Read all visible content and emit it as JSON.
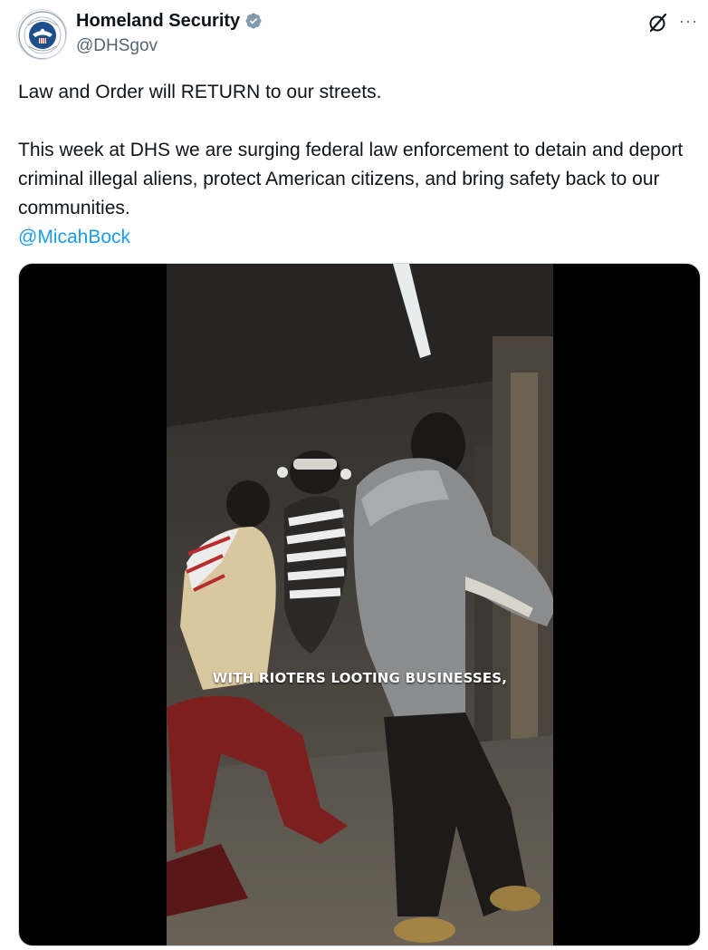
{
  "author": {
    "display_name": "Homeland Security",
    "handle": "@DHSgov",
    "verified_badge_color": "#829aab",
    "avatar_icon": "dhs-seal-icon"
  },
  "header_actions": {
    "grok_icon": "grok-icon",
    "more_icon": "more-options-icon",
    "more_label": "···"
  },
  "tweet": {
    "line1": "Law and Order will RETURN to our streets.",
    "line2": "This week at DHS we are surging federal law enforcement to detain and deport criminal illegal aliens, protect American citizens, and bring safety back to our communities.",
    "mention": "@MicahBock"
  },
  "media": {
    "type": "video",
    "caption": "WITH RIOTERS LOOTING BUSINESSES,"
  },
  "colors": {
    "text": "#0f1419",
    "secondary": "#536471",
    "link": "#1d9bf0"
  }
}
